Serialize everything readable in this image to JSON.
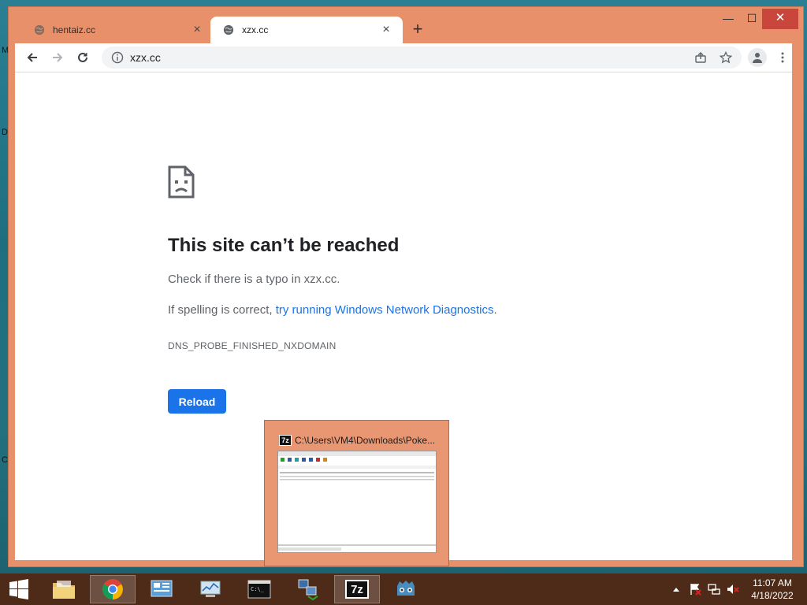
{
  "desktop": {
    "edge_letters": [
      "M",
      "D",
      "C"
    ]
  },
  "browser": {
    "tabs": [
      {
        "title": "hentaiz.cc",
        "active": false
      },
      {
        "title": "xzx.cc",
        "active": true
      }
    ],
    "new_tab": "+",
    "window_controls": {
      "minimize": "—",
      "maximize": "☐",
      "close": "✕"
    },
    "address": "xzx.cc"
  },
  "error_page": {
    "title": "This site can’t be reached",
    "typo_line": "Check if there is a typo in xzx.cc.",
    "spelling_prefix": "If spelling is correct, ",
    "diagnostics_link": "try running Windows Network Diagnostics",
    "spelling_suffix": ".",
    "error_code": "DNS_PROBE_FINISHED_NXDOMAIN",
    "reload_label": "Reload"
  },
  "preview": {
    "app_badge": "7z",
    "title": "C:\\Users\\VM4\\Downloads\\Poke..."
  },
  "taskbar": {
    "apps": [
      "file-explorer",
      "chrome",
      "control-panel",
      "performance-monitor",
      "command-prompt",
      "network-tool",
      "7zip",
      "godot"
    ],
    "active_badge": "7z",
    "clock_time": "11:07 AM",
    "clock_date": "4/18/2022"
  },
  "colors": {
    "window_frame": "#e8906a",
    "link": "#1a73e8",
    "taskbar": "#4e2a18"
  }
}
